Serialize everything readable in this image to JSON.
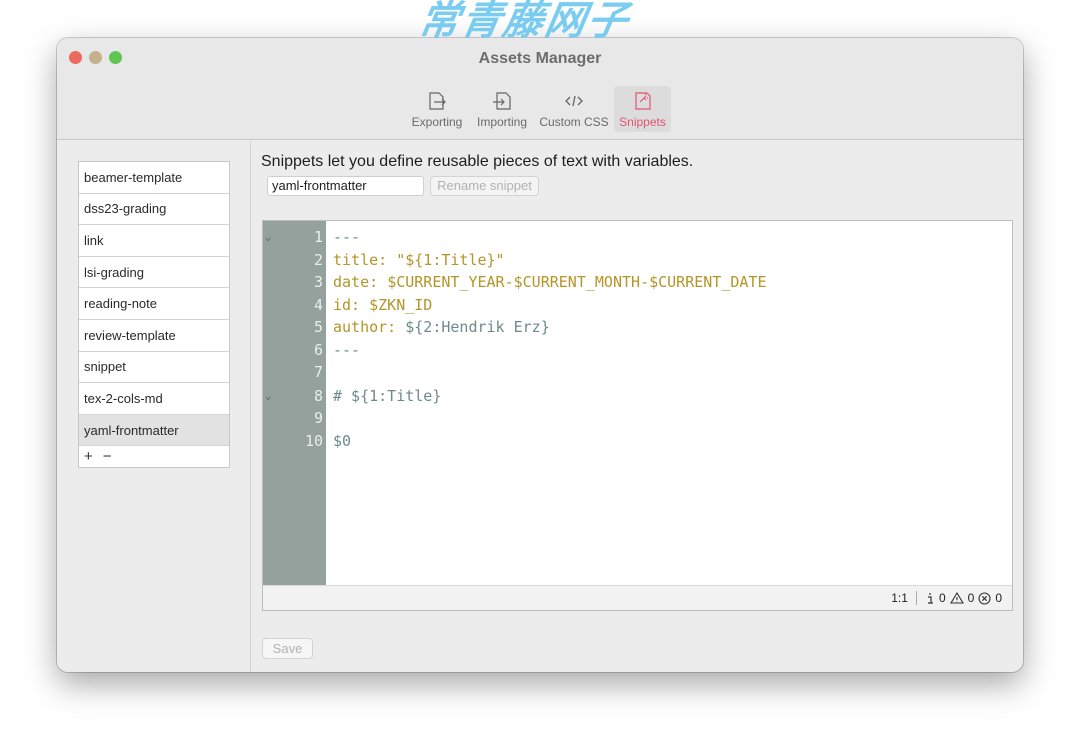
{
  "window": {
    "title": "Assets Manager",
    "watermark": "常青藤网子"
  },
  "toolbar": {
    "items": [
      {
        "label": "Exporting",
        "icon": "export-icon"
      },
      {
        "label": "Importing",
        "icon": "import-icon"
      },
      {
        "label": "Custom CSS",
        "icon": "code-icon"
      },
      {
        "label": "Snippets",
        "icon": "snippet-icon",
        "active": true
      }
    ],
    "accent": "#e0566f"
  },
  "sidebar": {
    "items": [
      {
        "label": "beamer-template"
      },
      {
        "label": "dss23-grading"
      },
      {
        "label": "link"
      },
      {
        "label": "lsi-grading"
      },
      {
        "label": "reading-note"
      },
      {
        "label": "review-template"
      },
      {
        "label": "snippet"
      },
      {
        "label": "tex-2-cols-md"
      },
      {
        "label": "yaml-frontmatter",
        "selected": true
      }
    ],
    "add_label": "+",
    "remove_label": "−"
  },
  "main": {
    "description": "Snippets let you define reusable pieces of text with variables.",
    "snippet_name": "yaml-frontmatter",
    "rename_label": "Rename snippet",
    "save_label": "Save"
  },
  "editor": {
    "lines": [
      {
        "num": "1",
        "fold": true
      },
      {
        "num": "2"
      },
      {
        "num": "3"
      },
      {
        "num": "4"
      },
      {
        "num": "5"
      },
      {
        "num": "6"
      },
      {
        "num": "7"
      },
      {
        "num": "8",
        "fold": true
      },
      {
        "num": "9"
      },
      {
        "num": "10"
      }
    ],
    "code": {
      "l1": "---",
      "l2_key": "title: ",
      "l2_val": "\"${1:Title}\"",
      "l3_key": "date: ",
      "l3_val": "$CURRENT_YEAR-$CURRENT_MONTH-$CURRENT_DATE",
      "l4_key": "id: ",
      "l4_val": "$ZKN_ID",
      "l5_key": "author: ",
      "l5_val": "${2:Hendrik Erz}",
      "l6": "---",
      "l8": "# ${1:Title}",
      "l10": "$0"
    },
    "status": {
      "cursor": "1:1",
      "info_count": "0",
      "warning_count": "0",
      "error_count": "0"
    },
    "colors": {
      "gutter": "#94a19c",
      "key": "#b39528",
      "placeholder": "#6e8a8a"
    }
  }
}
